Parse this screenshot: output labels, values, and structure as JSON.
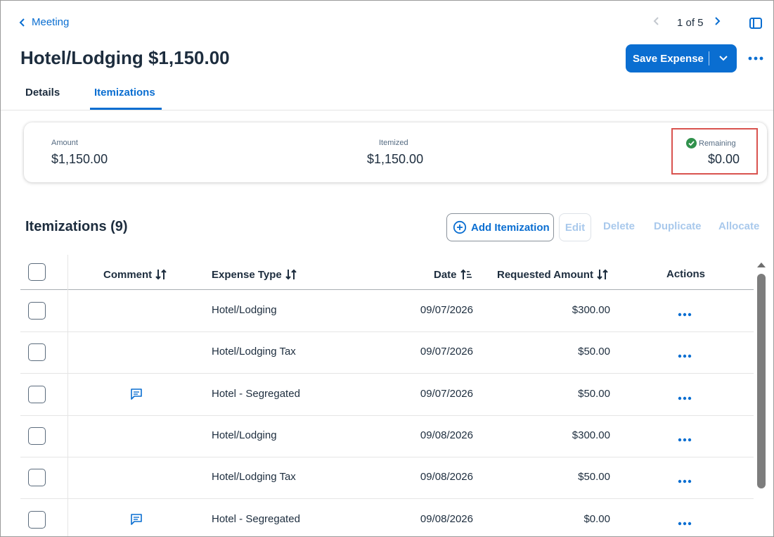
{
  "header": {
    "back_label": "Meeting",
    "pager_text": "1 of 5",
    "title": "Hotel/Lodging $1,150.00",
    "save_label": "Save Expense"
  },
  "tabs": [
    {
      "label": "Details",
      "selected": false
    },
    {
      "label": "Itemizations",
      "selected": true
    }
  ],
  "summary": {
    "amount_label": "Amount",
    "amount_value": "$1,150.00",
    "itemized_label": "Itemized",
    "itemized_value": "$1,150.00",
    "remaining_label": "Remaining",
    "remaining_value": "$0.00"
  },
  "section": {
    "title": "Itemizations (9)",
    "add_label": "Add Itemization",
    "edit_label": "Edit",
    "delete_label": "Delete",
    "duplicate_label": "Duplicate",
    "allocate_label": "Allocate"
  },
  "table": {
    "columns": {
      "comment": "Comment",
      "expense_type": "Expense Type",
      "date": "Date",
      "requested_amount": "Requested Amount",
      "actions": "Actions"
    },
    "rows": [
      {
        "has_comment": false,
        "expense_type": "Hotel/Lodging",
        "date": "09/07/2026",
        "amount": "$300.00"
      },
      {
        "has_comment": false,
        "expense_type": "Hotel/Lodging Tax",
        "date": "09/07/2026",
        "amount": "$50.00"
      },
      {
        "has_comment": true,
        "expense_type": "Hotel - Segregated",
        "date": "09/07/2026",
        "amount": "$50.00"
      },
      {
        "has_comment": false,
        "expense_type": "Hotel/Lodging",
        "date": "09/08/2026",
        "amount": "$300.00"
      },
      {
        "has_comment": false,
        "expense_type": "Hotel/Lodging Tax",
        "date": "09/08/2026",
        "amount": "$50.00"
      },
      {
        "has_comment": true,
        "expense_type": "Hotel - Segregated",
        "date": "09/08/2026",
        "amount": "$0.00"
      }
    ]
  },
  "colors": {
    "accent": "#0a6ed1",
    "disabled_text": "#a9c9ec",
    "success": "#30914c",
    "highlight_border": "#d9534f"
  }
}
